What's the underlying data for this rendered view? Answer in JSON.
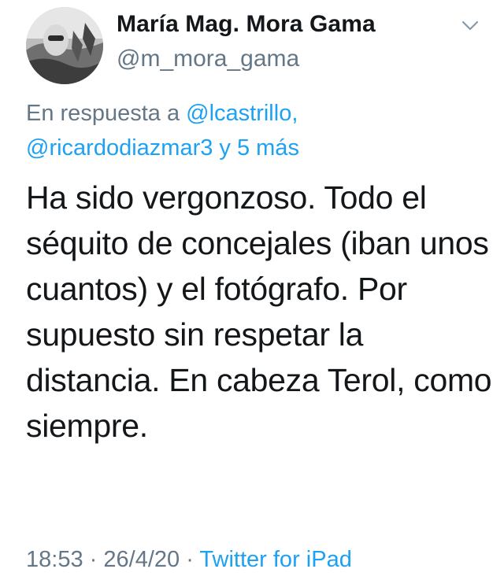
{
  "author": {
    "name": "María Mag. Mora Gama",
    "handle": "@m_mora_gama"
  },
  "reply": {
    "prefix": "En respuesta a",
    "mention_1": "@lcastrillo,",
    "mention_2": "@ricardodiazmar3 y 5 más"
  },
  "tweet": {
    "text": "Ha sido vergonzoso. Todo el séquito de concejales (iban unos cuantos) y el fotógrafo. Por supuesto sin respetar la distancia. En cabeza Terol, como siempre."
  },
  "meta": {
    "time": "18:53",
    "separator_1": "·",
    "date": "26/4/20",
    "separator_2": "·",
    "source": "Twitter for iPad"
  },
  "icons": {
    "menu": "chevron-down-icon"
  },
  "colors": {
    "primary_text": "#14171a",
    "secondary_text": "#657786",
    "link": "#1da1f2"
  }
}
